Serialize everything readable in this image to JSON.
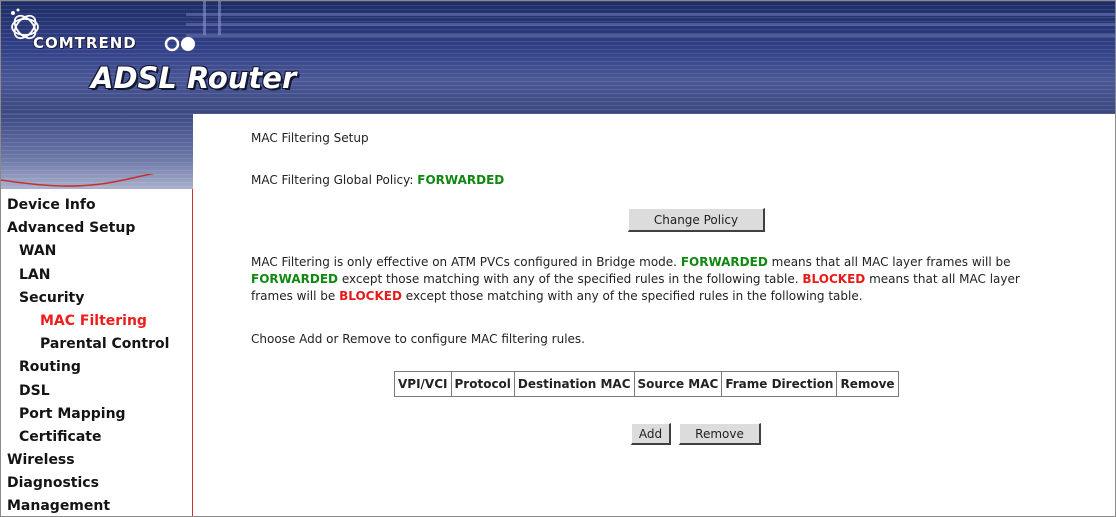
{
  "header": {
    "brand": "COMTREND",
    "product": "ADSL Router"
  },
  "sidebar": {
    "items": [
      {
        "label": "Device Info",
        "level": 1,
        "active": false
      },
      {
        "label": "Advanced Setup",
        "level": 1,
        "active": false
      },
      {
        "label": "WAN",
        "level": 2,
        "active": false
      },
      {
        "label": "LAN",
        "level": 2,
        "active": false
      },
      {
        "label": "Security",
        "level": 2,
        "active": false
      },
      {
        "label": "MAC Filtering",
        "level": 3,
        "active": true
      },
      {
        "label": "Parental Control",
        "level": 3,
        "active": false
      },
      {
        "label": "Routing",
        "level": 2,
        "active": false
      },
      {
        "label": "DSL",
        "level": 2,
        "active": false
      },
      {
        "label": "Port Mapping",
        "level": 2,
        "active": false
      },
      {
        "label": "Certificate",
        "level": 2,
        "active": false
      },
      {
        "label": "Wireless",
        "level": 1,
        "active": false
      },
      {
        "label": "Diagnostics",
        "level": 1,
        "active": false
      },
      {
        "label": "Management",
        "level": 1,
        "active": false
      }
    ]
  },
  "main": {
    "title": "MAC Filtering Setup",
    "policy_label": "MAC Filtering Global Policy:",
    "policy_value": "FORWARDED",
    "change_policy_button": "Change Policy",
    "description": {
      "l1_a": "MAC Filtering is only effective on ATM PVCs configured in Bridge mode.",
      "l1_kw": "FORWARDED",
      "l1_b": "means that all MAC layer frames will be",
      "l2_kw": "FORWARDED",
      "l2_a": "except those matching with any of the specified rules in the following table.",
      "l2_kw2": "BLOCKED",
      "l2_b": "means that all MAC layer",
      "l3_a": "frames will be",
      "l3_kw": "BLOCKED",
      "l3_b": "except those matching with any of the specified rules in the following table."
    },
    "instruction": "Choose Add or Remove to configure MAC filtering rules.",
    "table": {
      "columns": [
        "VPI/VCI",
        "Protocol",
        "Destination MAC",
        "Source MAC",
        "Frame Direction",
        "Remove"
      ],
      "rows": []
    },
    "add_button": "Add",
    "remove_button": "Remove"
  },
  "colors": {
    "banner": "#34428a",
    "sidebar_active": "#ee1c1c",
    "forwarded": "#118811",
    "blocked": "#e81b1b",
    "sidebar_border": "#cc3333"
  },
  "icons": [
    "comtrend-logo-swirl-icon",
    "brand-dots-icon"
  ]
}
